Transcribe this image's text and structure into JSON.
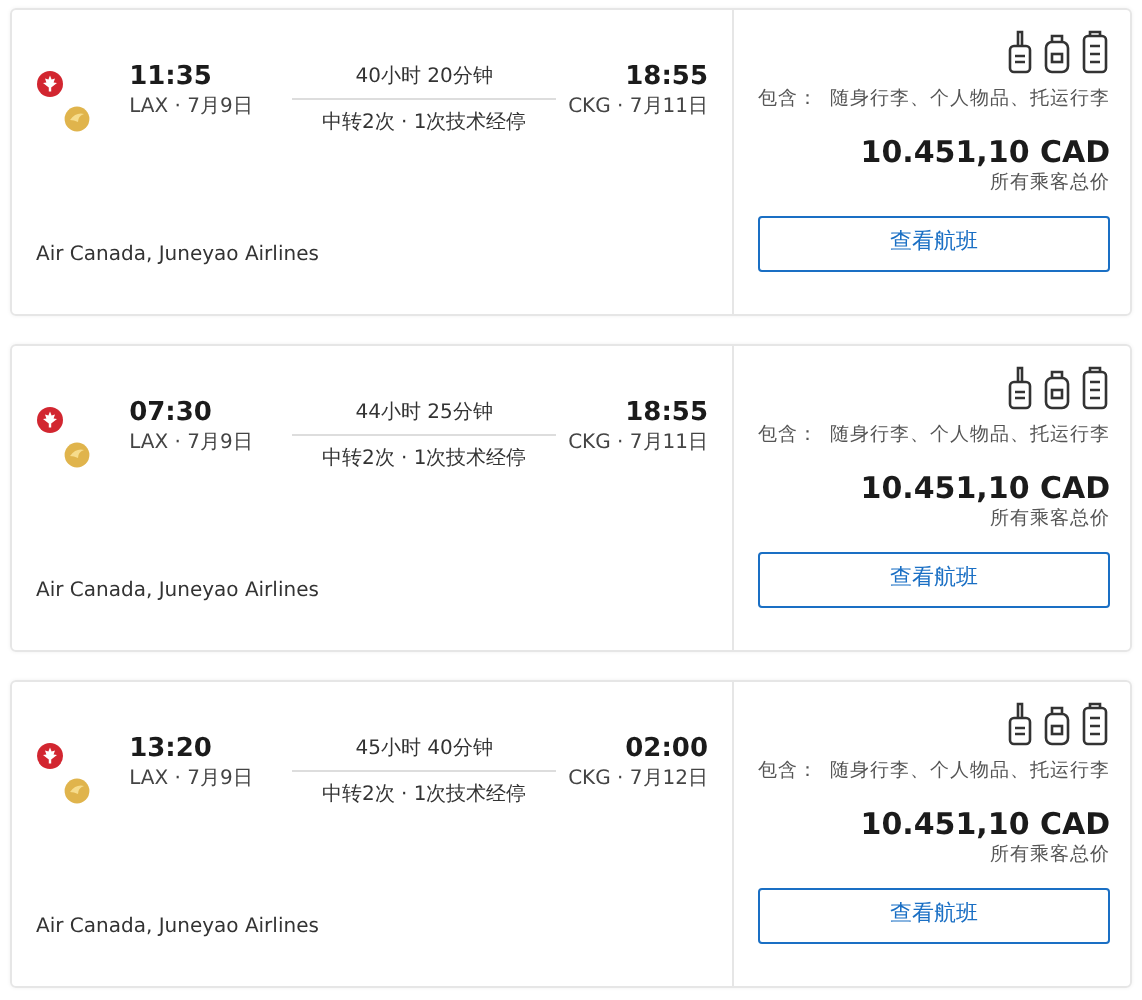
{
  "flights": [
    {
      "depart_time": "11:35",
      "depart_info": "LAX · 7月9日",
      "duration": "40小时 20分钟",
      "stops": "中转2次 · 1次技术经停",
      "arrive_time": "18:55",
      "arrive_info": "CKG · 7月11日",
      "airlines": "Air Canada, Juneyao Airlines",
      "includes": "包含：  随身行李、个人物品、托运行李",
      "price": "10.451,10 CAD",
      "price_note": "所有乘客总价",
      "button": "查看航班"
    },
    {
      "depart_time": "07:30",
      "depart_info": "LAX · 7月9日",
      "duration": "44小时 25分钟",
      "stops": "中转2次 · 1次技术经停",
      "arrive_time": "18:55",
      "arrive_info": "CKG · 7月11日",
      "airlines": "Air Canada, Juneyao Airlines",
      "includes": "包含：  随身行李、个人物品、托运行李",
      "price": "10.451,10 CAD",
      "price_note": "所有乘客总价",
      "button": "查看航班"
    },
    {
      "depart_time": "13:20",
      "depart_info": "LAX · 7月9日",
      "duration": "45小时 40分钟",
      "stops": "中转2次 · 1次技术经停",
      "arrive_time": "02:00",
      "arrive_info": "CKG · 7月12日",
      "airlines": "Air Canada, Juneyao Airlines",
      "includes": "包含：  随身行李、个人物品、托运行李",
      "price": "10.451,10 CAD",
      "price_note": "所有乘客总价",
      "button": "查看航班"
    }
  ]
}
